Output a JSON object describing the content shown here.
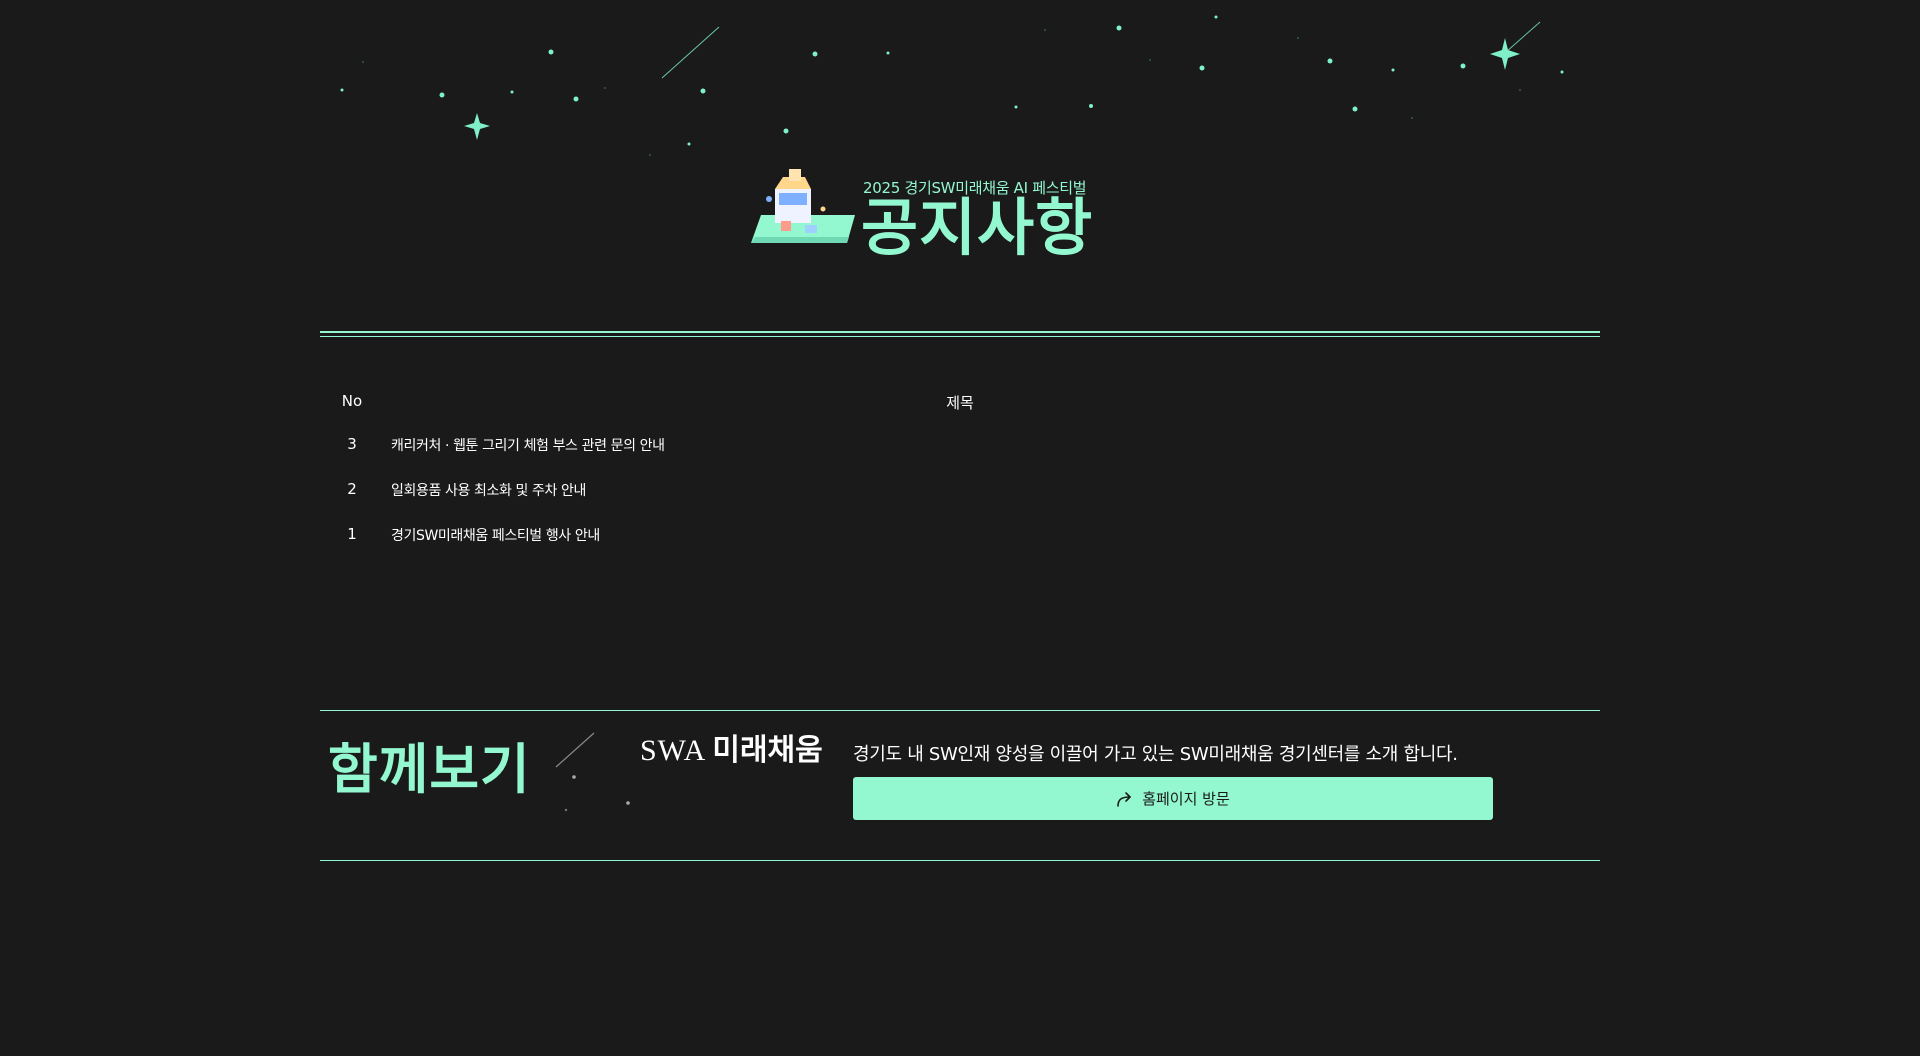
{
  "hero": {
    "subtitle": "2025 경기SW미래채움 AI 페스티벌",
    "title": "공지사항"
  },
  "board": {
    "headers": {
      "no": "No",
      "title": "제목"
    },
    "rows": [
      {
        "no": "3",
        "title": "캐리커처 · 웹툰 그리기 체험 부스 관련 문의 안내"
      },
      {
        "no": "2",
        "title": "일회용품 사용 최소화 및 주차 안내"
      },
      {
        "no": "1",
        "title": "경기SW미래채움 페스티벌 행사 안내"
      }
    ]
  },
  "related": {
    "title": "함께보기",
    "logo_latin": "SWA",
    "logo_korean": "미래채움",
    "description": "경기도 내 SW인재 양성을 이끌어 가고 있는 SW미래채움 경기센터를 소개 합니다.",
    "button_label": "홈페이지 방문",
    "button_icon": "share-arrow-icon"
  },
  "colors": {
    "background": "#1a1a1a",
    "accent": "#93f7d0",
    "text": "#ffffff"
  }
}
